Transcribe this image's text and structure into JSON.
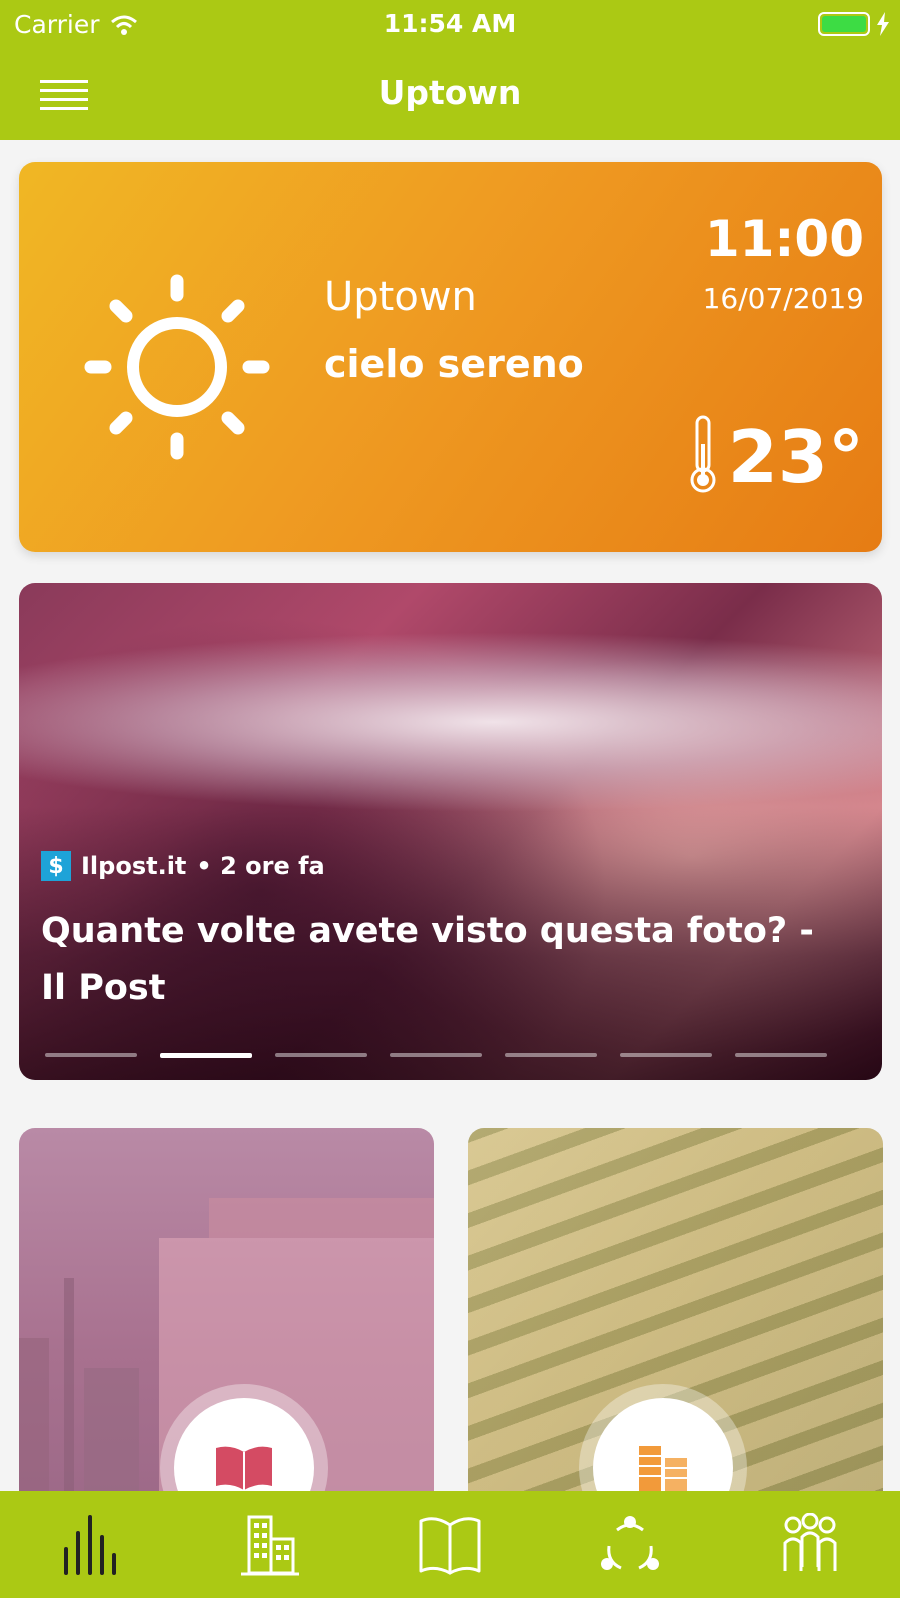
{
  "status_bar": {
    "carrier": "Carrier",
    "time": "11:54 AM"
  },
  "nav": {
    "title": "Uptown",
    "menu_icon": "hamburger-menu-icon"
  },
  "weather": {
    "city": "Uptown",
    "description": "cielo sereno",
    "time": "11:00",
    "date": "16/07/2019",
    "temperature": "23°",
    "icon": "sun-icon",
    "colors": {
      "gradient_start": "#f0b724",
      "gradient_end": "#e67c14"
    }
  },
  "news": {
    "source": "Ilpost.it",
    "age": "• 2 ore fa",
    "title": "Quante volte avete visto questa foto? - Il Post",
    "page_count": 7,
    "active_page": 2
  },
  "tiles": [
    {
      "icon": "open-book-icon",
      "icon_color": "#d44b63"
    },
    {
      "icon": "building-icon",
      "icon_color": "#f29a3a"
    }
  ],
  "tabbar": {
    "tabs": [
      {
        "icon": "bars-icon",
        "active": true
      },
      {
        "icon": "buildings-icon",
        "active": false
      },
      {
        "icon": "book-icon",
        "active": false
      },
      {
        "icon": "share-cycle-icon",
        "active": false
      },
      {
        "icon": "people-icon",
        "active": false
      }
    ]
  },
  "colors": {
    "brand_green": "#abc914",
    "background": "#f4f4f4"
  }
}
